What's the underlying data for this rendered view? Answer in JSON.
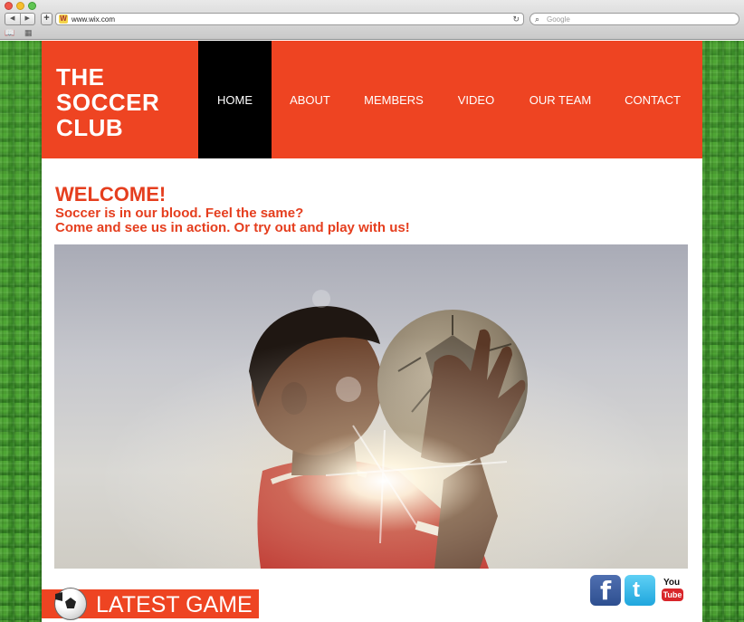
{
  "browser": {
    "url": "www.wix.com",
    "search_placeholder": "Google",
    "back_glyph": "◀",
    "forward_glyph": "▶",
    "new_tab_glyph": "+",
    "reload_glyph": "↻",
    "search_glyph": "⌕",
    "bookmarks_glyph": "📖",
    "apps_glyph": "▦",
    "favicon_glyph": "W"
  },
  "site": {
    "logo_lines": [
      "THE",
      "SOCCER",
      "CLUB"
    ],
    "nav": [
      {
        "label": "HOME",
        "active": true
      },
      {
        "label": "ABOUT",
        "active": false
      },
      {
        "label": "MEMBERS",
        "active": false
      },
      {
        "label": "VIDEO",
        "active": false
      },
      {
        "label": "OUR TEAM",
        "active": false
      },
      {
        "label": "CONTACT",
        "active": false
      }
    ],
    "welcome_title": "WELCOME!",
    "welcome_line1": "Soccer is in our blood. Feel the same?",
    "welcome_line2": "Come and see us in action. Or try out and play with us!",
    "latest_game_label": "LATEST GAME",
    "social": {
      "facebook_glyph": "f",
      "twitter_glyph": "t",
      "youtube_you": "You",
      "youtube_tube": "Tube"
    }
  },
  "colors": {
    "brand_orange": "#ee4422",
    "heading_orange": "#e53e1e",
    "nav_active": "#000000"
  }
}
